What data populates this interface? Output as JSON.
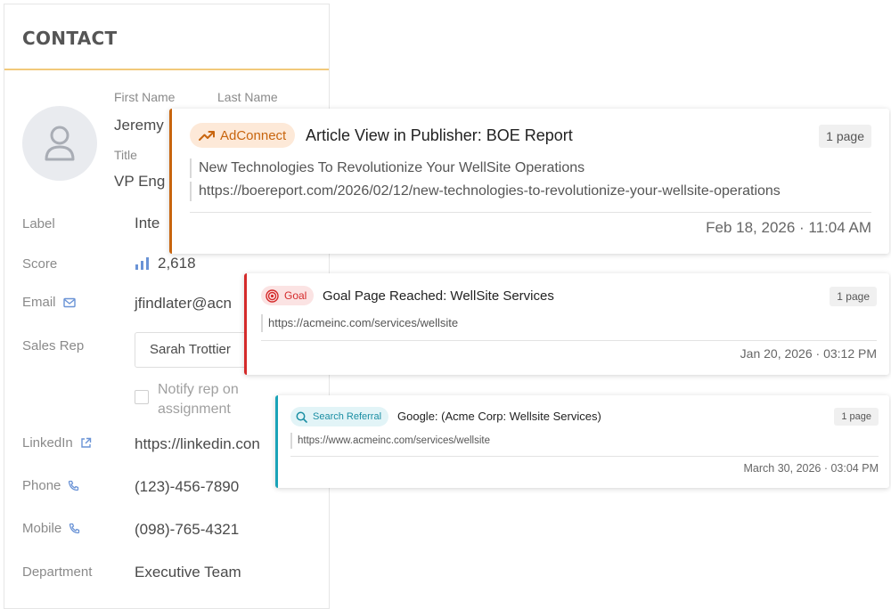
{
  "contact": {
    "title": "CONTACT",
    "first_name_label": "First Name",
    "last_name_label": "Last Name",
    "first_name_value": "Jeremy",
    "title_label": "Title",
    "title_value": "VP Eng",
    "label_label": "Label",
    "label_value": "Inte",
    "score_label": "Score",
    "score_value": "2,618",
    "email_label": "Email",
    "email_value": "jfindlater@acn",
    "sales_rep_label": "Sales Rep",
    "sales_rep_value": "Sarah Trottier",
    "notify_label_line1": "Notify rep on",
    "notify_label_line2": "assignment",
    "linkedin_label": "LinkedIn",
    "linkedin_value": "https://linkedin.con",
    "phone_label": "Phone",
    "phone_value": "(123)-456-7890",
    "mobile_label": "Mobile",
    "mobile_value": "(098)-765-4321",
    "department_label": "Department",
    "department_value": "Executive Team"
  },
  "activities": [
    {
      "badge": "AdConnect",
      "badge_icon": "trending-up-icon",
      "accent": "#c8650e",
      "title": "Article View in Publisher: BOE Report",
      "pages": "1 page",
      "lines": [
        "New Technologies To Revolutionize Your WellSite Operations",
        "https://boereport.com/2026/02/12/new-technologies-to-revolutionize-your-wellsite-operations"
      ],
      "timestamp": "Feb 18, 2026 · 11:04 AM"
    },
    {
      "badge": "Goal",
      "badge_icon": "target-icon",
      "accent": "#d42a2a",
      "title": "Goal Page Reached: WellSite Services",
      "pages": "1 page",
      "lines": [
        "https://acmeinc.com/services/wellsite"
      ],
      "timestamp": "Jan 20, 2026 · 03:12 PM"
    },
    {
      "badge": "Search Referral",
      "badge_icon": "search-icon",
      "accent": "#1aa3b8",
      "title": "Google: (Acme Corp: Wellsite Services)",
      "pages": "1 page",
      "lines": [
        "https://www.acmeinc.com/services/wellsite"
      ],
      "timestamp": "March 30, 2026 · 03:04 PM"
    }
  ]
}
